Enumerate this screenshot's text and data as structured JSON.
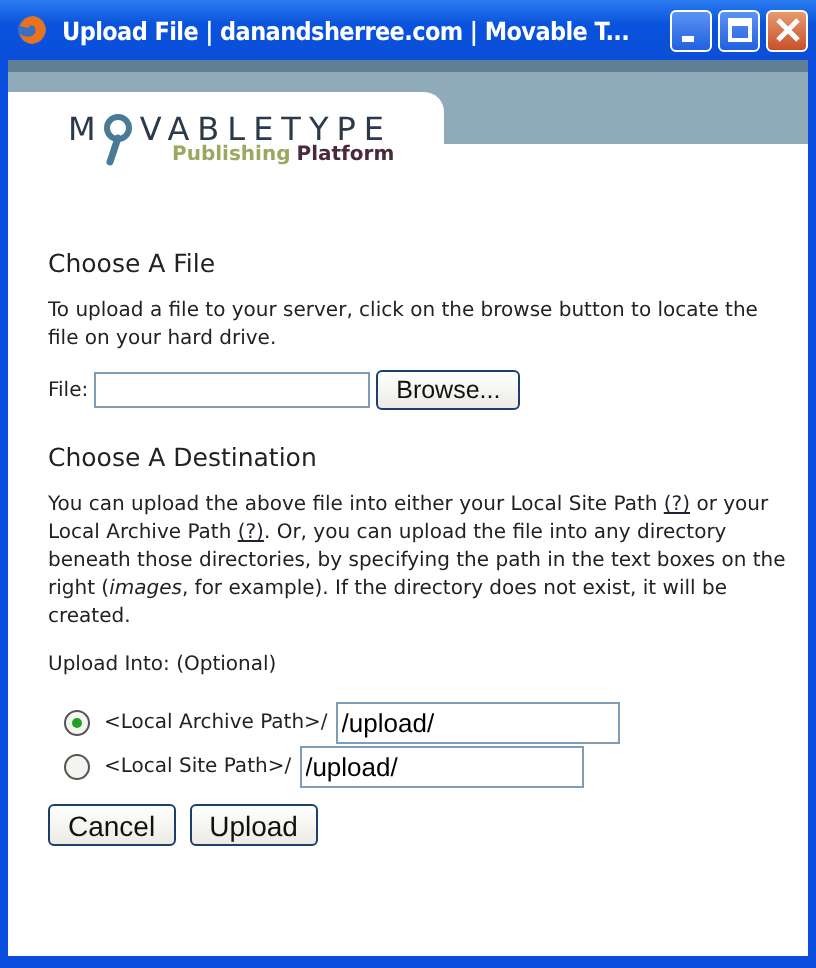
{
  "window": {
    "title": "Upload File | danandsherree.com | Movable T..."
  },
  "logo": {
    "word_start": "M",
    "word_end": "VABLETYPE",
    "tagline_start": "Publishing",
    "tagline_end": "Platform"
  },
  "file_section": {
    "heading": "Choose A File",
    "text": "To upload a file to your server, click on the browse button to locate the file on your hard drive.",
    "field_label": "File:",
    "browse_button": "Browse..."
  },
  "destination_section": {
    "heading": "Choose A Destination",
    "paragraph": [
      {
        "kind": "text",
        "text": "You can upload the above file into either your Local Site Path "
      },
      {
        "kind": "link",
        "text": "(?)"
      },
      {
        "kind": "text",
        "text": " or your Local Archive Path "
      },
      {
        "kind": "link",
        "text": "(?)"
      },
      {
        "kind": "text",
        "text": ". Or, you can upload the file into any directory beneath those directories, by specifying the path in the text boxes on the right (*images*, for example). If the directory does not exist, it will be created."
      }
    ],
    "upload_into_label": "Upload Into: (Optional)",
    "options": [
      {
        "label": "<Local Archive Path>/",
        "value": "/upload/",
        "selected": true
      },
      {
        "label": "<Local Site Path>/",
        "value": "/upload/",
        "selected": false
      }
    ]
  },
  "buttons": [
    "Cancel",
    "Upload"
  ]
}
